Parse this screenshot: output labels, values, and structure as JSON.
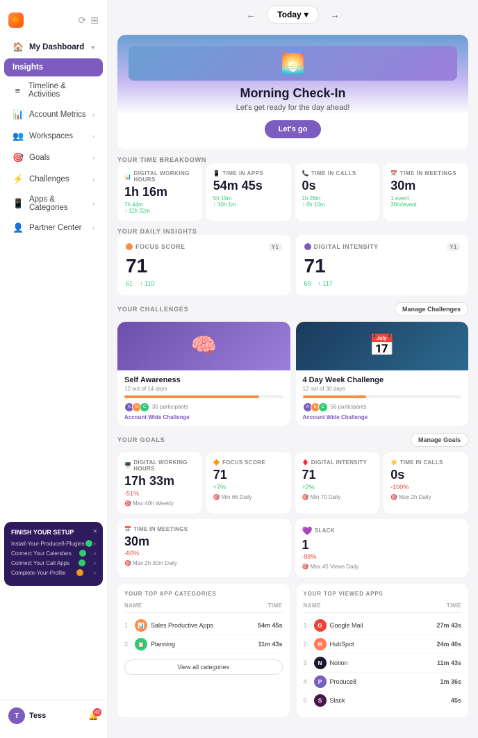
{
  "sidebar": {
    "logo": "🔶",
    "nav": [
      {
        "id": "dashboard",
        "label": "My Dashboard",
        "icon": "🏠",
        "hasChevron": true,
        "isParent": true
      },
      {
        "id": "insights",
        "label": "Insights",
        "icon": "",
        "isActive": true
      },
      {
        "id": "timeline",
        "label": "Timeline & Activities",
        "icon": "≡"
      },
      {
        "id": "account-metrics",
        "label": "Account Metrics",
        "icon": "📊",
        "hasChevron": true
      },
      {
        "id": "workspaces",
        "label": "Workspaces",
        "icon": "👥",
        "hasChevron": true
      },
      {
        "id": "goals",
        "label": "Goals",
        "icon": "🎯",
        "hasChevron": true
      },
      {
        "id": "challenges",
        "label": "Challenges",
        "icon": "⚡",
        "hasChevron": true
      },
      {
        "id": "apps",
        "label": "Apps & Categories",
        "icon": "📱",
        "hasChevron": true
      },
      {
        "id": "partner",
        "label": "Partner Center",
        "icon": "👤",
        "hasChevron": true
      }
    ],
    "user": {
      "name": "Tess",
      "initials": "T"
    },
    "bell_count": "42"
  },
  "topnav": {
    "title": "Today",
    "prev_arrow": "←",
    "next_arrow": "→",
    "chevron": "▾"
  },
  "morning": {
    "title": "Morning Check-In",
    "subtitle": "Let's get ready for the day ahead!",
    "button": "Let's go"
  },
  "time_breakdown": {
    "label": "YOUR TIME BREAKDOWN",
    "cards": [
      {
        "id": "digital-working",
        "icon": "📊",
        "label": "DIGITAL WORKING HOURS",
        "value": "1h 16m",
        "sub1": "7h 44m",
        "sub2": "↑ 11h 22m"
      },
      {
        "id": "time-apps",
        "icon": "📱",
        "label": "TIME IN APPS",
        "value": "54m 45s",
        "sub1": "5h 19m",
        "sub2": "↑ 10h 1m"
      },
      {
        "id": "time-calls",
        "icon": "📞",
        "label": "TIME IN CALLS",
        "value": "0s",
        "sub1": "1h 28m",
        "sub2": "↑ 6h 10m"
      },
      {
        "id": "time-meetings",
        "icon": "📅",
        "label": "TIME IN MEETINGS",
        "value": "30m",
        "sub1": "1 event",
        "sub2": "30m/event"
      }
    ]
  },
  "daily_insights": {
    "label": "YOUR DAILY INSIGHTS",
    "cards": [
      {
        "id": "focus-score",
        "dot": "orange",
        "label": "FOCUS SCORE",
        "badge": "Y1",
        "value": "71",
        "sub1": "61",
        "sub2": "↑ 110"
      },
      {
        "id": "digital-intensity",
        "dot": "purple",
        "label": "DIGITAL INTENSITY",
        "badge": "Y1",
        "value": "71",
        "sub1": "69",
        "sub2": "↑ 117"
      }
    ]
  },
  "challenges": {
    "label": "YOUR CHALLENGES",
    "manage_btn": "Manage Challenges",
    "items": [
      {
        "id": "self-awareness",
        "bg": "purple",
        "title": "Self Awareness",
        "sub": "12 out of 14 days",
        "progress": 85,
        "participants": "36 participants",
        "link": "Account Wide Challenge"
      },
      {
        "id": "4-day-week",
        "bg": "dark",
        "title": "4 Day Week Challenge",
        "sub": "12 out of 30 days",
        "progress": 40,
        "participants": "56 participants",
        "link": "Account Wide Challenge"
      }
    ]
  },
  "goals": {
    "label": "YOUR GOALS",
    "manage_btn": "Manage Goals",
    "items": [
      {
        "id": "digital-working-hours",
        "icon": "🖥️",
        "label": "Digital Working Hours",
        "value": "17h 33m",
        "change": "-51%",
        "change_type": "neg",
        "target": "Max 40h Weekly"
      },
      {
        "id": "focus-score-goal",
        "icon": "🔶",
        "label": "Focus Score",
        "value": "71",
        "change": "+7%",
        "change_type": "pos",
        "target": "Min 66 Daily"
      },
      {
        "id": "digital-intensity-goal",
        "icon": "♦️",
        "label": "Digital Intensity",
        "value": "71",
        "change": "+2%",
        "change_type": "pos",
        "target": "Min 70 Daily"
      },
      {
        "id": "time-calls-goal",
        "icon": "☀️",
        "label": "Time in Calls",
        "value": "0s",
        "change": "-100%",
        "change_type": "neg",
        "target": "Max 2h Daily"
      },
      {
        "id": "time-meetings-goal",
        "icon": "📅",
        "label": "Time in Meetings",
        "value": "30m",
        "change": "-60%",
        "change_type": "neg",
        "target": "Max 2h 30m Daily"
      },
      {
        "id": "slack-goal",
        "icon": "💜",
        "label": "Slack",
        "value": "1",
        "change": "-98%",
        "change_type": "neg",
        "target": "Max 45 Views Daily"
      }
    ]
  },
  "top_categories": {
    "label": "YOUR TOP APP CATEGORIES",
    "header_name": "NAME",
    "header_time": "TIME",
    "items": [
      {
        "rank": 1,
        "name": "Sales Productive Apps",
        "time": "54m 45s",
        "color": "#ff8c42"
      },
      {
        "rank": 2,
        "name": "Planning",
        "time": "11m 43s",
        "color": "#2ecc71"
      }
    ],
    "view_all_btn": "View all categories"
  },
  "top_apps": {
    "label": "YOUR TOP VIEWED APPS",
    "header_name": "NAME",
    "header_time": "TIME",
    "items": [
      {
        "rank": 1,
        "name": "Google Mail",
        "time": "27m 43s",
        "color": "#EA4335",
        "icon": "G"
      },
      {
        "rank": 2,
        "name": "HubSpot",
        "time": "24m 40s",
        "color": "#FF7A59",
        "icon": "H"
      },
      {
        "rank": 3,
        "name": "Notion",
        "time": "11m 43s",
        "color": "#1a1a2e",
        "icon": "N"
      },
      {
        "rank": 4,
        "name": "Produce8",
        "time": "1m 36s",
        "color": "#7c5cbf",
        "icon": "P"
      },
      {
        "rank": 5,
        "name": "Slack",
        "time": "45s",
        "color": "#4A154B",
        "icon": "S"
      }
    ]
  },
  "setup": {
    "title": "FINISH YOUR SETUP",
    "items": [
      {
        "text": "Install-Your-Produce8-Plugins",
        "status": "green"
      },
      {
        "text": "Connect Your Calendars",
        "status": "green"
      },
      {
        "text": "Connect Your Call Apps",
        "status": "green"
      },
      {
        "text": "Complete-Your-Profile",
        "status": "yellow"
      }
    ],
    "close": "×"
  }
}
